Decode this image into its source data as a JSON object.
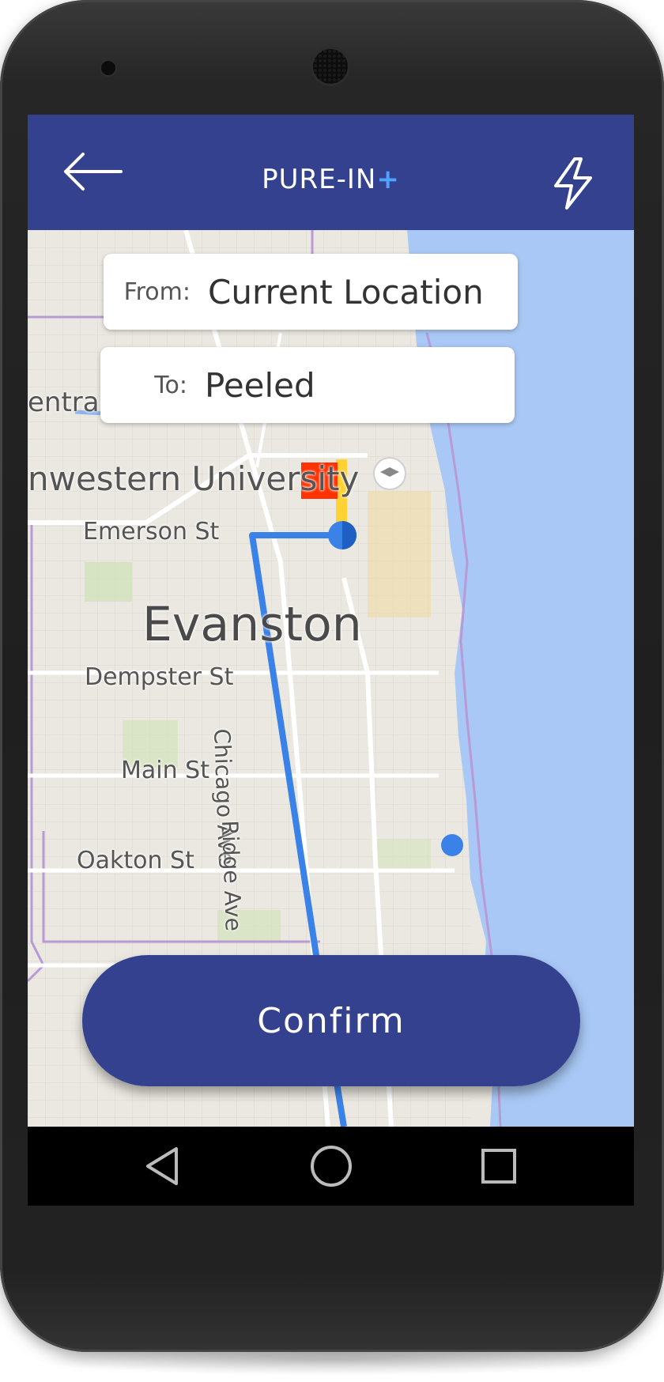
{
  "app": {
    "title_main": "PURE-IN",
    "title_plus": "+"
  },
  "route_form": {
    "from_label": "From:",
    "from_value": "Current Location",
    "to_label": "To:",
    "to_value": "Peeled"
  },
  "map": {
    "labels": {
      "central_st": "entral St",
      "university": "nwestern University",
      "emerson": "Emerson St",
      "city": "Evanston",
      "dempster": "Dempster St",
      "main": "Main St",
      "oakton": "Oakton St",
      "chicago_ave": "Chicago Ave",
      "ridge_ave": "Ridge Ave"
    },
    "colors": {
      "route": "#3b82e8",
      "destination_marker": "#ff3300",
      "connector": "#ffd234",
      "water": "#a9c8f5"
    }
  },
  "actions": {
    "confirm_label": "Confirm"
  },
  "icons": {
    "back": "arrow-left-icon",
    "lightning": "lightning-icon",
    "nav_back": "triangle-back-icon",
    "nav_home": "circle-home-icon",
    "nav_recents": "square-recents-icon"
  },
  "theme": {
    "appbar": "#34418f",
    "accent": "#4fa3ff"
  }
}
